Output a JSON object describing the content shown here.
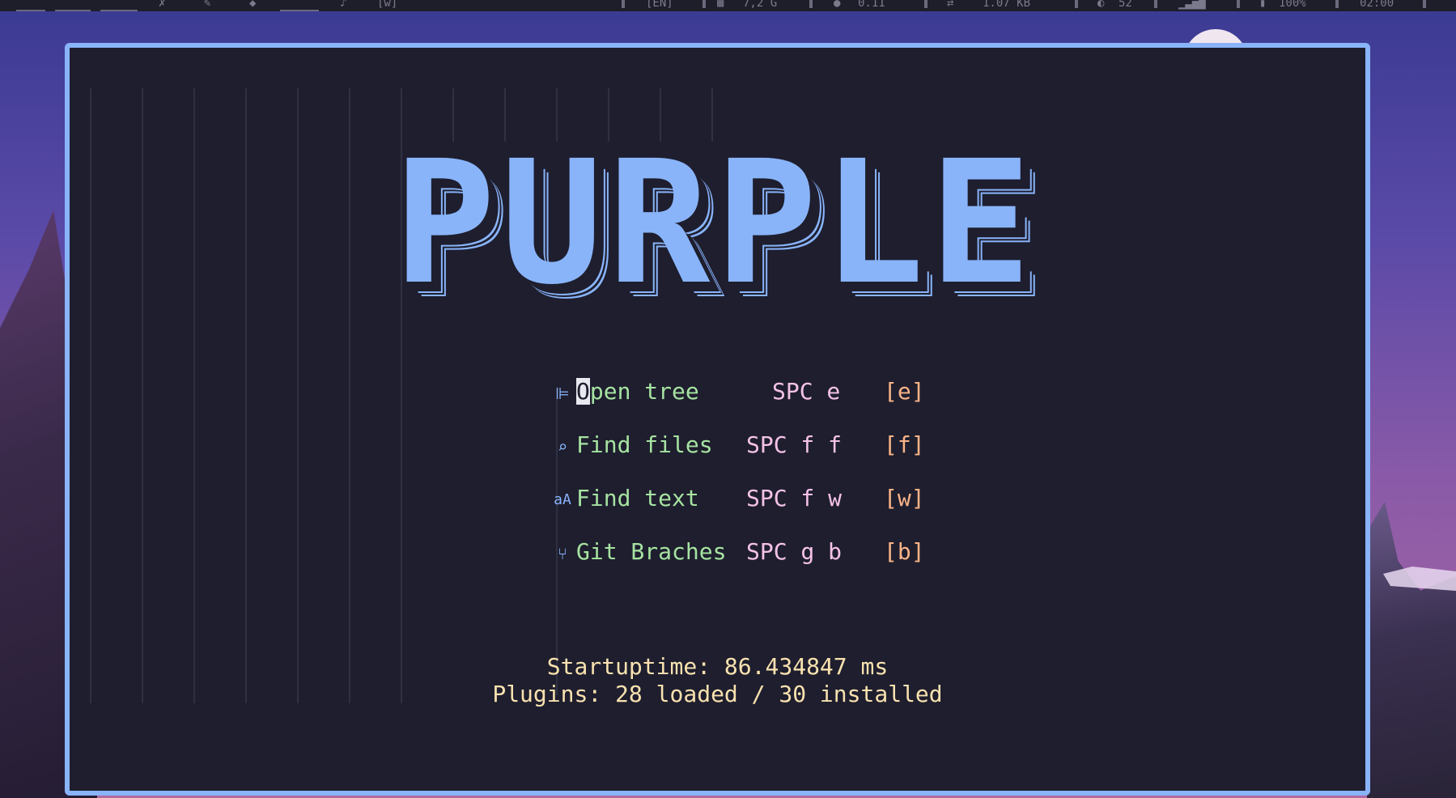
{
  "topbar": {
    "layout": "[EN]",
    "memory": "7,2 G",
    "load": "0.11",
    "network": "1.07 KB",
    "temperature": "52",
    "brightness": "100%",
    "time": "02:00",
    "workspace": "[w]"
  },
  "dashboard": {
    "logo": "PURPLE",
    "buttons": [
      {
        "icon": "tree-icon",
        "label_first": "O",
        "label_rest": "pen tree",
        "keys": "SPC e",
        "hint": "[e]"
      },
      {
        "icon": "file-search-icon",
        "label": "Find files",
        "keys": "SPC f f",
        "hint": "[f]"
      },
      {
        "icon": "text-icon",
        "label": "Find text",
        "keys": "SPC f w",
        "hint": "[w]"
      },
      {
        "icon": "git-branch-icon",
        "label": "Git Braches",
        "keys": "SPC g b",
        "hint": "[b]"
      }
    ],
    "footer": {
      "startuptime": "Startuptime: 86.434847 ms",
      "plugins": "Plugins: 28 loaded / 30 installed"
    }
  },
  "colors": {
    "accent": "#89b4fa",
    "label": "#a6e3a1",
    "keys": "#f5c2e7",
    "hint": "#fab387",
    "footer": "#f9e2af",
    "background": "#1e1e2e"
  }
}
